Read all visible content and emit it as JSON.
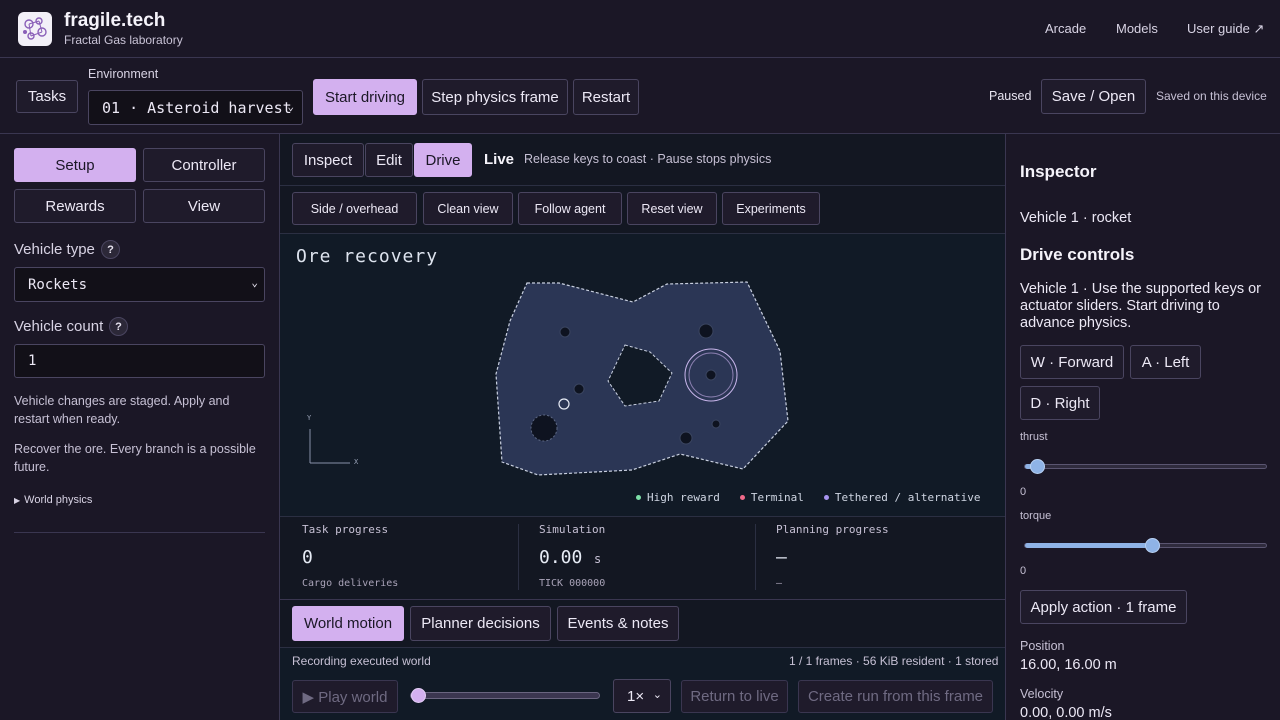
{
  "brand": {
    "name": "fragile.tech",
    "subtitle": "Fractal Gas laboratory"
  },
  "nav": [
    {
      "label": "Arcade"
    },
    {
      "label": "Models"
    },
    {
      "label": "User guide ↗"
    }
  ],
  "toolbar": {
    "tasks_label": "Tasks",
    "environment_label": "Environment",
    "environment_value": "01 · Asteroid harvest",
    "start_label": "Start driving",
    "step_label": "Step physics frame",
    "restart_label": "Restart",
    "status": "Paused",
    "save_label": "Save / Open",
    "saved_status": "Saved on this device"
  },
  "left": {
    "tabs": [
      {
        "label": "Setup",
        "active": true
      },
      {
        "label": "Controller",
        "active": false
      },
      {
        "label": "Rewards",
        "active": false
      },
      {
        "label": "View",
        "active": false
      }
    ],
    "vehicle_type_label": "Vehicle type",
    "vehicle_type_value": "Rockets",
    "vehicle_count_label": "Vehicle count",
    "vehicle_count_value": "1",
    "help_glyph": "?",
    "note1": "Vehicle changes are staged. Apply and restart when ready.",
    "note2": "Recover the ore. Every branch is a possible future.",
    "world_physics": "World physics"
  },
  "center": {
    "modes": [
      {
        "label": "Inspect",
        "active": false
      },
      {
        "label": "Edit",
        "active": false
      },
      {
        "label": "Drive",
        "active": true
      }
    ],
    "live_label": "Live",
    "live_hint": "Release keys to coast · Pause stops physics",
    "view_buttons": [
      "Side / overhead",
      "Clean view",
      "Follow agent",
      "Reset view",
      "Experiments"
    ],
    "scene_title": "Ore recovery",
    "axis_y": "Y",
    "axis_x": "X",
    "legend": [
      {
        "label": "High reward",
        "color": "#7ee0a8"
      },
      {
        "label": "Terminal",
        "color": "#f06a8a"
      },
      {
        "label": "Tethered / alternative",
        "color": "#a894f0"
      }
    ],
    "stats": [
      {
        "label": "Task progress",
        "value": "0",
        "unit": "",
        "sub": "Cargo deliveries"
      },
      {
        "label": "Simulation",
        "value": "0.00",
        "unit": "s",
        "sub": "TICK 000000"
      },
      {
        "label": "Planning progress",
        "value": "—",
        "unit": "",
        "sub": "—"
      }
    ],
    "bottom_tabs": [
      {
        "label": "World motion",
        "active": true
      },
      {
        "label": "Planner decisions",
        "active": false
      },
      {
        "label": "Events & notes",
        "active": false
      }
    ],
    "recording_label": "Recording executed world",
    "recording_stats": "1 / 1 frames · 56 KiB resident · 1 stored",
    "play_label": "▶ Play world",
    "playback_progress": 0,
    "speed": "1×",
    "return_label": "Return to live",
    "create_run_label": "Create run from this frame"
  },
  "right": {
    "title": "Inspector",
    "vehicle": "Vehicle 1 · rocket",
    "drive_title": "Drive controls",
    "drive_desc": "Vehicle 1 · Use the supported keys or actuator sliders. Start driving to advance physics.",
    "keys": [
      "W · Forward",
      "A · Left",
      "D · Right"
    ],
    "thrust_label": "thrust",
    "thrust_value": "0",
    "thrust_level": 0.03,
    "torque_label": "torque",
    "torque_value": "0",
    "torque_level": 0.5,
    "apply_label": "Apply action · 1 frame",
    "position_label": "Position",
    "position_value": "16.00, 16.00 m",
    "velocity_label": "Velocity",
    "velocity_value": "0.00, 0.00 m/s"
  },
  "colors": {
    "accent": "#d3b0ef",
    "panel_bg": "#1b1726",
    "canvas_bg": "#111a26",
    "terrain": "#2b3655"
  }
}
